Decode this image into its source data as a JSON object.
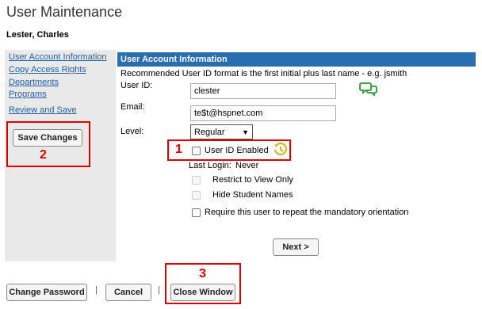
{
  "page": {
    "title": "User Maintenance",
    "user_name": "Lester, Charles"
  },
  "sidebar": {
    "links": [
      {
        "label": "User Account Information"
      },
      {
        "label": "Copy Access Rights"
      },
      {
        "label": "Departments"
      },
      {
        "label": "Programs"
      },
      {
        "label": "Review and Save"
      }
    ],
    "save_button": "Save Changes"
  },
  "main": {
    "header": "User Account Information",
    "hint": "Recommended User ID format is the first initial plus last name - e.g. jsmith",
    "user_id_label": "User ID:",
    "user_id_value": "clester",
    "email_label": "Email:",
    "email_value": "te$t@hspnet.com",
    "level_label": "Level:",
    "level_value": "Regular",
    "user_id_enabled_label": "User ID Enabled",
    "last_login_label": "Last Login:",
    "last_login_value": "Never",
    "restrict_label": "Restrict to View Only",
    "hide_names_label": "Hide Student Names",
    "orientation_label": "Require this user to repeat the mandatory orientation",
    "next_button": "Next >"
  },
  "footer": {
    "change_password": "Change Password",
    "separator": "|",
    "cancel": "Cancel",
    "close_window": "Close Window"
  },
  "annotations": {
    "one": "1",
    "two": "2",
    "three": "3"
  },
  "icons": {
    "chat": "speech-bubbles-icon",
    "history": "history-icon"
  },
  "colors": {
    "header_bg": "#2a6db0",
    "link": "#1f5fa8",
    "highlight": "#e00000",
    "chat_icon": "#3aa64a",
    "history_icon": "#e0b020"
  }
}
